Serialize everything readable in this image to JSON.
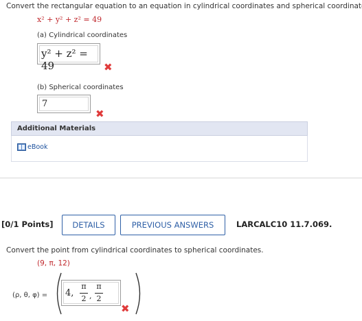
{
  "q1": {
    "prompt": "Convert the rectangular equation to an equation in cylindrical coordinates and spherical coordinates.",
    "equation": "x² + y² + z² = 49",
    "part_a_label": "(a) Cylindrical coordinates",
    "part_a_answer": "y² + z² = 49",
    "part_b_label": "(b) Spherical coordinates",
    "part_b_answer": "7",
    "a_status": "✖",
    "b_status": "✖"
  },
  "materials": {
    "heading": "Additional Materials",
    "ebook_label": "eBook",
    "icon": "book-icon"
  },
  "q2": {
    "points": "[0/1 Points]",
    "details_btn": "DETAILS",
    "prev_btn": "PREVIOUS ANSWERS",
    "ref": "LARCALC10 11.7.069.",
    "prompt": "Convert the point from cylindrical coordinates to spherical coordinates.",
    "point": "(9, π, 12)",
    "answer_label": "(ρ, θ, φ) =",
    "answer_first": "4,",
    "frac1_num": "π",
    "frac1_den": "2",
    "frac2_num": "π",
    "frac2_den": "2",
    "status": "✖"
  },
  "colors": {
    "error_red": "#e03b3b",
    "link_blue": "#2e5fa6",
    "materials_bg": "#e2e6f2"
  }
}
